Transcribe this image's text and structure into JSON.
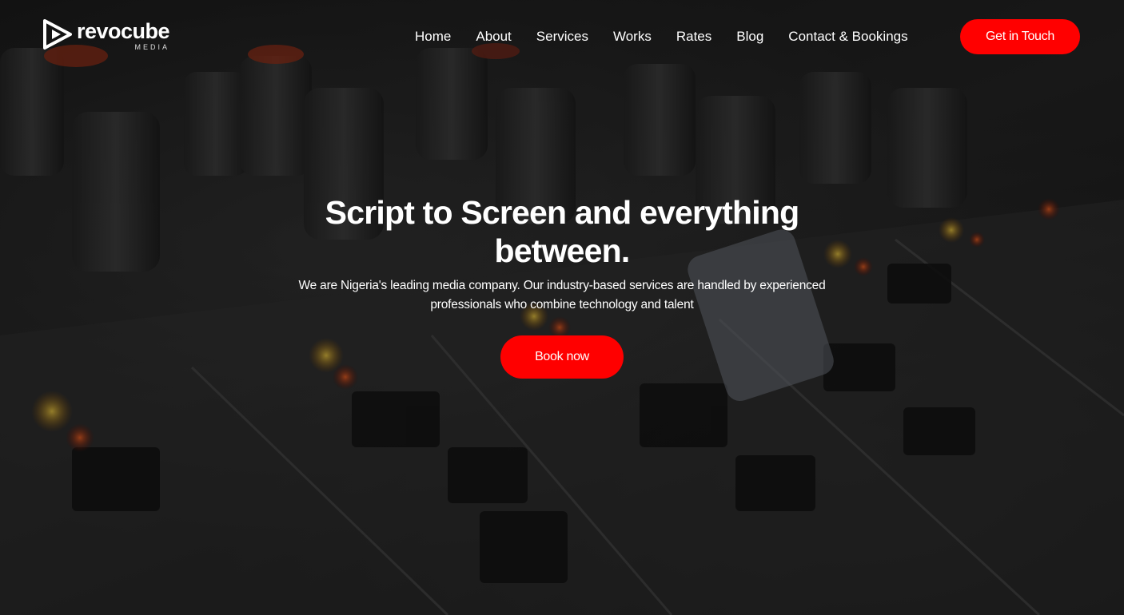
{
  "brand": {
    "name": "revocube",
    "tagline": "MEDIA",
    "logo_icon": "revocube-logo-icon"
  },
  "nav": {
    "items": [
      {
        "label": "Home"
      },
      {
        "label": "About"
      },
      {
        "label": "Services"
      },
      {
        "label": "Works"
      },
      {
        "label": "Rates"
      },
      {
        "label": "Blog"
      },
      {
        "label": "Contact & Bookings"
      }
    ],
    "cta_label": "Get in Touch"
  },
  "hero": {
    "headline": "Script to Screen and everything between.",
    "subtext": "We are Nigeria's leading media company. Our industry-based services are handled by experienced professionals who combine technology and talent",
    "button_label": "Book now"
  },
  "colors": {
    "accent": "#ff0000",
    "text": "#ffffff",
    "background": "#1c1c1c"
  }
}
